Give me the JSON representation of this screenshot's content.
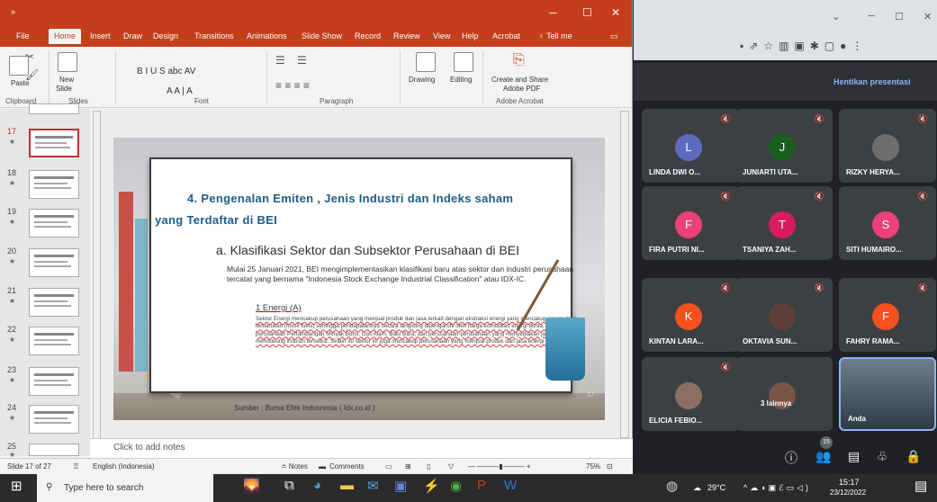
{
  "ppt": {
    "tabs": [
      "File",
      "Home",
      "Insert",
      "Draw",
      "Design",
      "Transitions",
      "Animations",
      "Slide Show",
      "Record",
      "Review",
      "View",
      "Help",
      "Acrobat",
      "Tell me"
    ],
    "quick_access": "»",
    "ribbon": {
      "paste": "Paste",
      "new_slide": "New",
      "new_slide2": "Slide",
      "drawing": "Drawing",
      "editing": "Editing",
      "create_share": "Create and Share",
      "adobe_pdf": "Adobe PDF",
      "font_buttons": "B  I  U  S  abc  AV",
      "font_size": "A  A  |  A",
      "groups": [
        "Clipboard",
        "Slides",
        "Font",
        "Paragraph",
        "Adobe Acrobat"
      ]
    },
    "thumbnails": [
      {
        "num": "17",
        "star": "★"
      },
      {
        "num": "18",
        "star": "★"
      },
      {
        "num": "19",
        "star": "★"
      },
      {
        "num": "20",
        "star": "★"
      },
      {
        "num": "21",
        "star": "★"
      },
      {
        "num": "22",
        "star": "★"
      },
      {
        "num": "23",
        "star": "★"
      },
      {
        "num": "24",
        "star": "★"
      },
      {
        "num": "25",
        "star": "★"
      }
    ],
    "slide": {
      "title_line1": "4. Pengenalan Emiten , Jenis Industri dan Indeks saham",
      "title_line2": "yang Terdaftar di BEI",
      "subtitle": "a.  Klasifikasi Sektor dan Subsektor Perusahaan di BEI",
      "paragraph": "Mulai 25 Januari 2021, BEI mengimplementasikan klasifikasi baru atas sektor dan industri perusahaan tercatat yang bernama \"Indonesia Stock Exchange Industrial Classification\" atau IDX-IC.",
      "section": "1 Energi (A)",
      "section_body": "Sektor Energi mencakup perusahaan yang menjual produk dan jasa terkait dengan ekstraksi energi yang mencakup energi tidak terbarukan (fossil fuels) sehingga pendapatannya secara langsung dipengaruhi oleh harga komoditas energi dunia, seperti perusahaan Pertambangan Minyak Bumi, Gas Alam, Batu Bara, dan perusahaan-perusahaan yang menyediakan jasa yang mendukung industri tersebut. Selain itu sektor ini juga mencakup perusahaan yang menjual produk dan jasa energi alternatif.",
      "source": "Sumber : Bursa Efek Indosnesia ( Idx.co.id )",
      "page": "17"
    },
    "notes_placeholder": "Click to add notes",
    "status": {
      "slide": "Slide 17 of 27",
      "language": "English (Indonesia)",
      "notes": "≐ Notes",
      "comments": "Comments",
      "zoom": "75%"
    }
  },
  "meet": {
    "stop": "Hentikan presentasi",
    "participants": [
      {
        "name": "LINDA DWI O...",
        "initial": "L",
        "color": "#5c6bc0"
      },
      {
        "name": "JUNIARTI UTA...",
        "initial": "J",
        "color": "#1b5e20"
      },
      {
        "name": "RIZKY HERYA...",
        "initial": "",
        "color": "#6d6d6d"
      },
      {
        "name": "FIRA PUTRI NI...",
        "initial": "F",
        "color": "#ec407a"
      },
      {
        "name": "TSANIYA ZAH...",
        "initial": "T",
        "color": "#d81b60"
      },
      {
        "name": "SITI HUMAIRO...",
        "initial": "S",
        "color": "#ec407a"
      },
      {
        "name": "KINTAN LARA...",
        "initial": "K",
        "color": "#f4511e"
      },
      {
        "name": "OKTAVIA SUN...",
        "initial": "",
        "color": "#5d4037"
      },
      {
        "name": "FAHRY RAMA...",
        "initial": "F",
        "color": "#f4511e"
      },
      {
        "name": "ELICIA FEBIO...",
        "initial": "",
        "color": "#8d6e63"
      },
      {
        "name": "3 lainnya",
        "initial": "",
        "color": "#795548"
      },
      {
        "name": "Anda",
        "initial": "",
        "color": "#607d8b"
      }
    ],
    "people_count": "15"
  },
  "taskbar": {
    "search": "Type here to search",
    "temp": "29°C",
    "time": "15:17",
    "date": "23/12/2022"
  }
}
